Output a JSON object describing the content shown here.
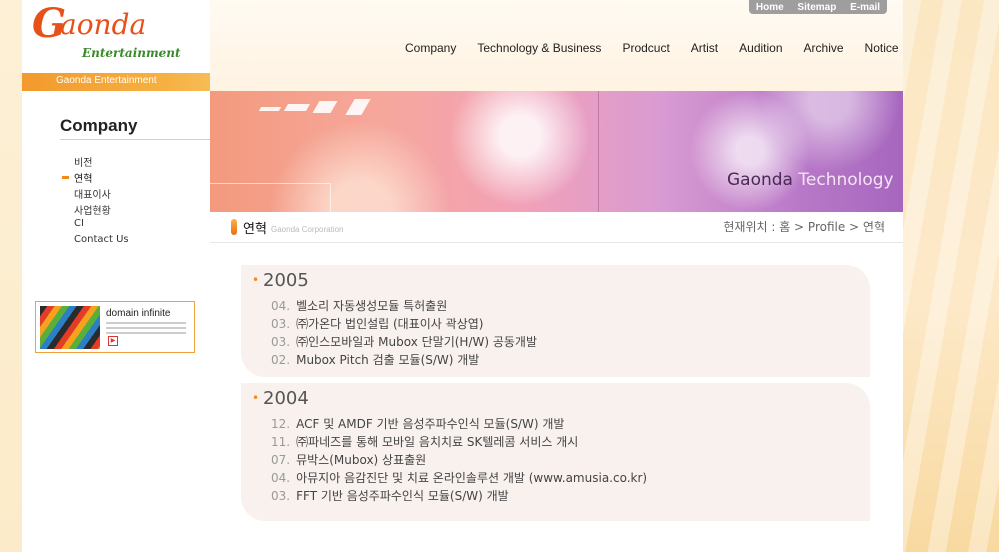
{
  "logo": {
    "mark": "G",
    "word": "aonda",
    "sub": "Entertainment"
  },
  "brand_bar": "Gaonda Entertainment",
  "utility_nav": [
    "Home",
    "Sitemap",
    "E-mail"
  ],
  "main_nav": [
    "Company",
    "Technology & Business",
    "Prodcuct",
    "Artist",
    "Audition",
    "Archive",
    "Notice"
  ],
  "sidebar": {
    "title": "Company",
    "items": [
      "비전",
      "연혁",
      "대표이사",
      "사업현황",
      "CI",
      "Contact Us"
    ],
    "active_index": 1
  },
  "banner_ad": {
    "title": "domain infinite"
  },
  "hero": {
    "caption_main": "Gaonda ",
    "caption_soft": "Technology"
  },
  "page": {
    "title": "연혁",
    "subtitle": "Gaonda Corporation",
    "breadcrumb": "현재위치 : 홈 > Profile > 연혁"
  },
  "history": [
    {
      "year": "2005",
      "events": [
        {
          "month": "04.",
          "text": "벨소리 자동생성모듈 특허출원"
        },
        {
          "month": "03.",
          "text": "㈜가온다 법인설립 (대표이사 곽상엽)"
        },
        {
          "month": "03.",
          "text": "㈜인스모바일과 Mubox 단말기(H/W) 공동개발"
        },
        {
          "month": "02.",
          "text": "Mubox Pitch 검출 모듈(S/W) 개발"
        }
      ]
    },
    {
      "year": "2004",
      "events": [
        {
          "month": "12.",
          "text": "ACF 및 AMDF 기반 음성주파수인식 모듈(S/W) 개발"
        },
        {
          "month": "11.",
          "text": "㈜파네즈를 통해 모바일 음치치료 SK텔레콤 서비스 개시"
        },
        {
          "month": "07.",
          "text": "뮤박스(Mubox) 상표출원"
        },
        {
          "month": "04.",
          "text": "아뮤지아 음감진단 및 치료 온라인솔루션 개발 (www.amusia.co.kr)"
        },
        {
          "month": "03.",
          "text": "FFT 기반 음성주파수인식 모듈(S/W) 개발"
        }
      ]
    }
  ]
}
